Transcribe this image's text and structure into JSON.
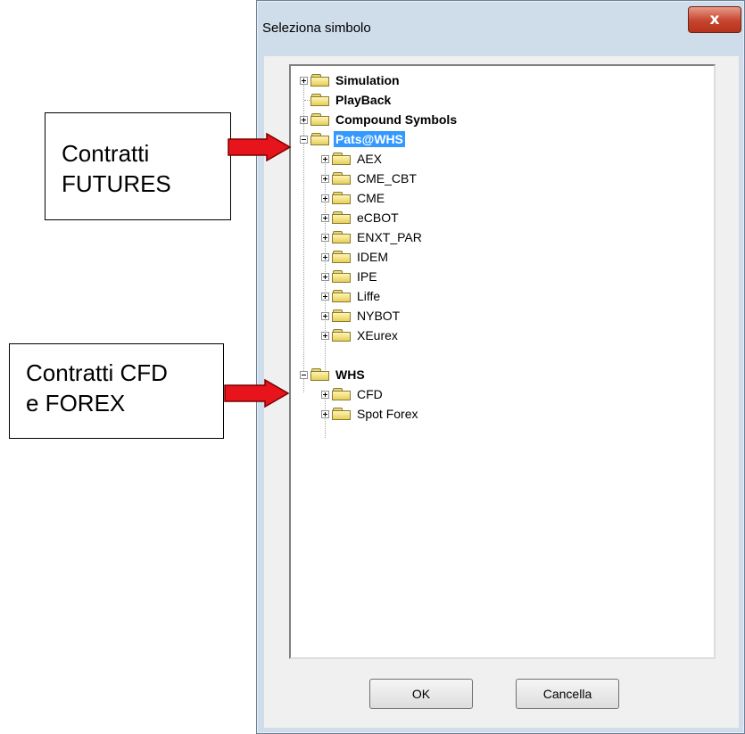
{
  "window": {
    "title": "Seleziona simbolo",
    "close_glyph": "x"
  },
  "tree": {
    "items": [
      {
        "label": "Simulation",
        "expander": "plus",
        "bold": true
      },
      {
        "label": "PlayBack",
        "expander": "none",
        "bold": true
      },
      {
        "label": "Compound Symbols",
        "expander": "plus",
        "bold": true
      },
      {
        "label": "Pats@WHS",
        "expander": "minus",
        "bold": true,
        "selected": true
      },
      {
        "label": "AEX",
        "expander": "plus"
      },
      {
        "label": "CME_CBT",
        "expander": "plus"
      },
      {
        "label": "CME",
        "expander": "plus"
      },
      {
        "label": "eCBOT",
        "expander": "plus"
      },
      {
        "label": "ENXT_PAR",
        "expander": "plus"
      },
      {
        "label": "IDEM",
        "expander": "plus"
      },
      {
        "label": "IPE",
        "expander": "plus"
      },
      {
        "label": "Liffe",
        "expander": "plus"
      },
      {
        "label": "NYBOT",
        "expander": "plus"
      },
      {
        "label": "XEurex",
        "expander": "plus"
      },
      {
        "label": "WHS",
        "expander": "minus",
        "bold": true
      },
      {
        "label": "CFD",
        "expander": "plus"
      },
      {
        "label": "Spot Forex",
        "expander": "plus"
      }
    ]
  },
  "buttons": {
    "ok_label": "OK",
    "cancel_label": "Cancella"
  },
  "annotations": {
    "futures_line1": "Contratti",
    "futures_line2": "FUTURES",
    "cfd_line1": "Contratti CFD",
    "cfd_line2": "e FOREX"
  },
  "colors": {
    "selection": "#3399ff",
    "arrow": "#e8141c",
    "close_button": "#c6452e"
  }
}
